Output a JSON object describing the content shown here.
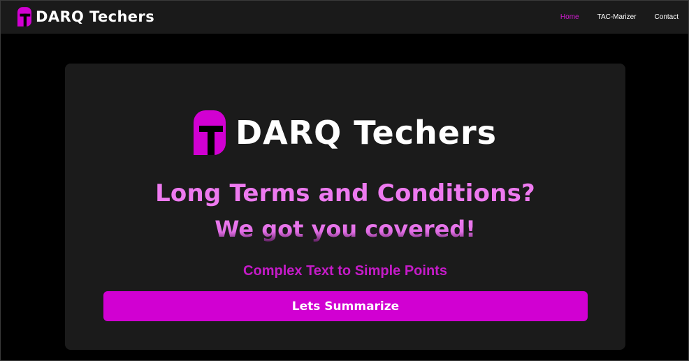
{
  "navbar": {
    "brand_text": "DARQ Techers",
    "links": [
      {
        "label": "Home",
        "active": true
      },
      {
        "label": "TAC-Marizer",
        "active": false
      },
      {
        "label": "Contact",
        "active": false
      }
    ]
  },
  "hero": {
    "brand_text": "DARQ Techers",
    "headline": "Long Terms and Conditions?",
    "headline2": "We got you covered!",
    "subtitle": "Complex Text to Simple Points",
    "cta_label": "Lets Summarize"
  },
  "colors": {
    "accent": "#d100d2",
    "headline": "#ee7af0",
    "subtitle": "#c51bc8",
    "nav_active": "#d41bd4",
    "card_bg": "#1b1b1b",
    "nav_bg": "#1a1a1a",
    "page_bg": "#000000"
  },
  "icons": {
    "logo": "dt-logo-icon"
  }
}
